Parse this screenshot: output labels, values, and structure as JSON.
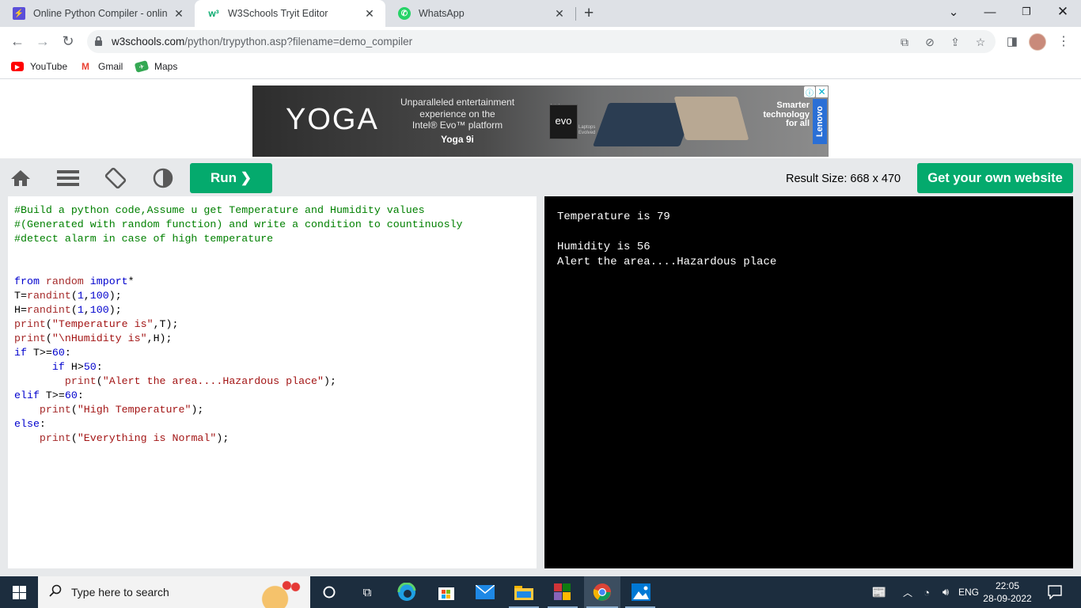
{
  "browser": {
    "tabs": [
      {
        "title": "Online Python Compiler - online",
        "favicon": "lightning-icon",
        "color": "#5b4fd9"
      },
      {
        "title": "W3Schools Tryit Editor",
        "favicon": "w3schools-icon",
        "color": "#04aa6d"
      },
      {
        "title": "WhatsApp",
        "favicon": "whatsapp-icon",
        "color": "#25d366"
      }
    ],
    "new_tab": "+",
    "url_host": "w3schools.com",
    "url_path": "/python/trypython.asp?filename=demo_compiler",
    "bookmarks": [
      {
        "label": "YouTube",
        "icon": "youtube-icon",
        "color": "#ff0000"
      },
      {
        "label": "Gmail",
        "icon": "gmail-icon",
        "color": "#ea4335"
      },
      {
        "label": "Maps",
        "icon": "maps-icon",
        "color": "#34a853"
      }
    ]
  },
  "ad": {
    "logo": "YOGA",
    "line1": "Unparalleled entertainment",
    "line2": "experience on the",
    "line3": "Intel® Evo™ platform",
    "product": "Yoga 9i",
    "evo_top": "intel",
    "evo": "evo",
    "laptops": "Laptops",
    "evolved": "Evolved",
    "smart1": "Smarter",
    "smart2": "technology",
    "smart3": "for all",
    "brand": "Lenovo"
  },
  "editor": {
    "run_label": "Run ❯",
    "result_size": "Result Size: 668 x 470",
    "get_site": "Get your own website"
  },
  "code": [
    "#Build a python code,Assume u get Temperature and Humidity values",
    "#(Generated with random function) and write a condition to countinuosly",
    "#detect alarm in case of high temperature",
    "",
    "",
    "from random import*",
    "T=randint(1,100);",
    "H=randint(1,100);",
    "print(\"Temperature is\",T);",
    "print(\"\\nHumidity is\",H);",
    "if T>=60:",
    "      if H>50:",
    "        print(\"Alert the area....Hazardous place\");",
    "elif T>=60:",
    "    print(\"High Temperature\");",
    "else:",
    "    print(\"Everything is Normal\");"
  ],
  "output": [
    "Temperature is 79",
    "",
    "Humidity is 56",
    "Alert the area....Hazardous place"
  ],
  "taskbar": {
    "search_placeholder": "Type here to search",
    "lang": "ENG",
    "time": "22:05",
    "date": "28-09-2022"
  }
}
